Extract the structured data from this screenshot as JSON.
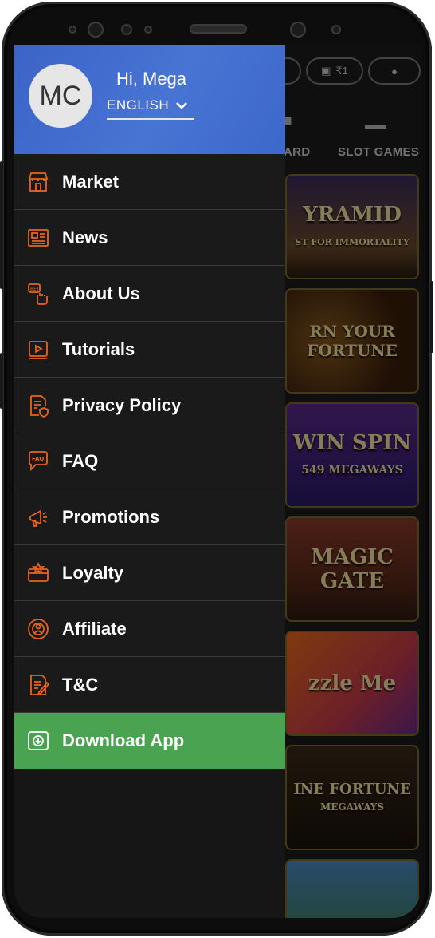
{
  "user": {
    "initials": "MC",
    "greeting": "Hi, Mega",
    "language": "ENGLISH"
  },
  "menu": [
    {
      "label": "Market",
      "icon": "market-icon"
    },
    {
      "label": "News",
      "icon": "news-icon"
    },
    {
      "label": "About Us",
      "icon": "about-us-icon"
    },
    {
      "label": "Tutorials",
      "icon": "tutorials-icon"
    },
    {
      "label": "Privacy Policy",
      "icon": "privacy-policy-icon"
    },
    {
      "label": "FAQ",
      "icon": "faq-icon"
    },
    {
      "label": "Promotions",
      "icon": "promotions-icon"
    },
    {
      "label": "Loyalty",
      "icon": "loyalty-icon"
    },
    {
      "label": "Affiliate",
      "icon": "affiliate-icon"
    },
    {
      "label": "T&C",
      "icon": "tnc-icon"
    },
    {
      "label": "Download App",
      "icon": "download-app-icon"
    }
  ],
  "background": {
    "wallet_balance": "₹1",
    "tabs": [
      "ARD",
      "SLOT GAMES"
    ],
    "games": [
      {
        "title": "YRAMID",
        "subtitle": "ST FOR IMMORTALITY"
      },
      {
        "title": "RN YOUR FORTUNE",
        "subtitle": ""
      },
      {
        "title": "WIN SPIN",
        "subtitle": "549 MEGAWAYS"
      },
      {
        "title": "MAGIC GATE",
        "subtitle": ""
      },
      {
        "title": "zzle Me",
        "subtitle": ""
      },
      {
        "title": "INE FORTUNE",
        "subtitle": "MEGAWAYS"
      },
      {
        "title": "",
        "subtitle": ""
      }
    ]
  },
  "colors": {
    "accent": "#e8641c",
    "header_blue": "#4470d0",
    "download_green": "#4aa351"
  }
}
